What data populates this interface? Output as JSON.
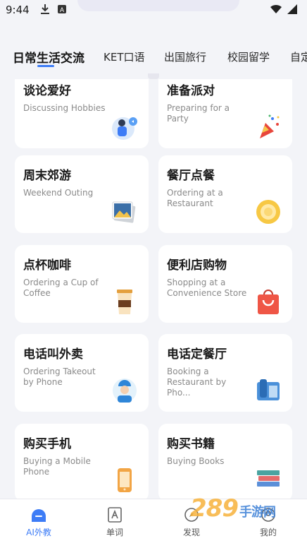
{
  "status": {
    "time": "9:44"
  },
  "tabs": [
    {
      "label": "日常生活交流",
      "active": true
    },
    {
      "label": "KET口语"
    },
    {
      "label": "出国旅行"
    },
    {
      "label": "校园留学"
    },
    {
      "label": "自定"
    }
  ],
  "cards": [
    {
      "title": "谈论爱好",
      "subtitle": "Discussing Hobbies",
      "icon": "hobbies-icon"
    },
    {
      "title": "准备派对",
      "subtitle": "Preparing for a Party",
      "icon": "party-popper-icon"
    },
    {
      "title": "周末郊游",
      "subtitle": "Weekend Outing",
      "icon": "photos-icon"
    },
    {
      "title": "餐厅点餐",
      "subtitle": "Ordering at a Restaurant",
      "icon": "plate-icon"
    },
    {
      "title": "点杯咖啡",
      "subtitle": "Ordering a Cup of Coffee",
      "icon": "coffee-cup-icon"
    },
    {
      "title": "便利店购物",
      "subtitle": "Shopping at a Convenience Store",
      "icon": "shopping-bag-icon"
    },
    {
      "title": "电话叫外卖",
      "subtitle": "Ordering Takeout by Phone",
      "icon": "delivery-person-icon"
    },
    {
      "title": "电话定餐厅",
      "subtitle": "Booking a Restaurant by Pho...",
      "icon": "telephone-icon"
    },
    {
      "title": "购买手机",
      "subtitle": "Buying a Mobile Phone",
      "icon": "mobile-phone-icon"
    },
    {
      "title": "购买书籍",
      "subtitle": "Buying Books",
      "icon": "books-icon"
    }
  ],
  "nav": {
    "ai": "AI外教",
    "words": "单词",
    "discover": "发现",
    "mine": "我的"
  },
  "watermark": {
    "main": "289",
    "sub": "手游网"
  },
  "colors": {
    "accent": "#3d7cf6",
    "background": "#f3f4f8"
  }
}
